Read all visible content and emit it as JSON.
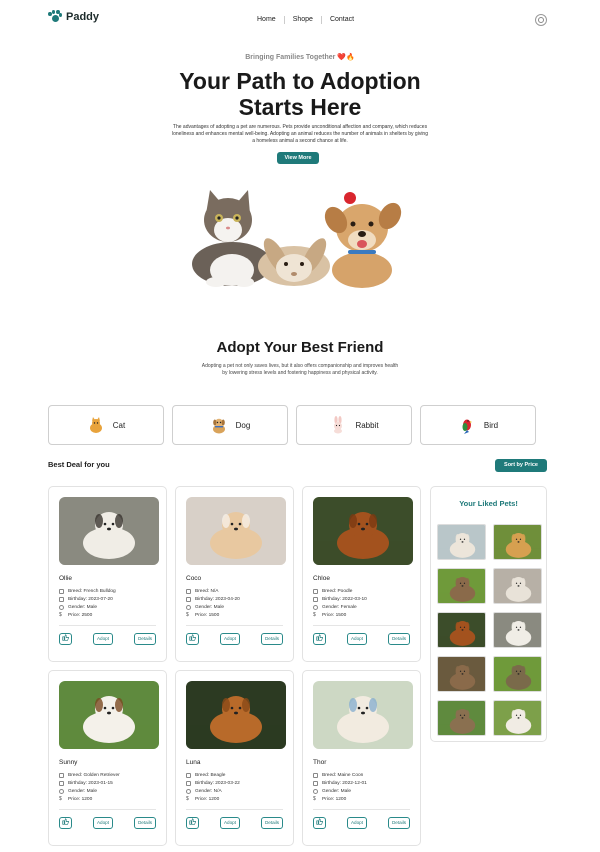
{
  "header": {
    "brand": "Paddy",
    "nav": [
      "Home",
      "Shope",
      "Contact"
    ]
  },
  "hero": {
    "tagline": "Bringing Families Together ❤️🔥",
    "title": "Your Path to Adoption Starts Here",
    "description": "The advantages of adopting a pet are numerous. Pets provide unconditional affection and company, which reduces loneliness and enhances mental well-being. Adopting an animal reduces the number of animals in shelters by giving a homeless animal a second chance at life.",
    "cta": "View More"
  },
  "adopt": {
    "title": "Adopt Your Best Friend",
    "description": "Adopting a pet not only saves lives, but it also offers companionship and improves health by lowering stress levels and fostering happiness and physical activity."
  },
  "categories": [
    {
      "label": "Cat",
      "icon": "cat-icon"
    },
    {
      "label": "Dog",
      "icon": "dog-icon"
    },
    {
      "label": "Rabbit",
      "icon": "rabbit-icon"
    },
    {
      "label": "Bird",
      "icon": "parrot-icon"
    }
  ],
  "deals": {
    "title": "Best Deal for you",
    "sort_label": "Sort by Price"
  },
  "labels": {
    "adopt": "Adopt",
    "details": "Details"
  },
  "pets": [
    {
      "name": "Ollie",
      "breed": "Breed: French Bulldog",
      "birthday": "Birthday: 2023-07-20",
      "gender": "Gender: Male",
      "price": "Price: 2500",
      "photo": "shih-tzu"
    },
    {
      "name": "Coco",
      "breed": "Breed: N/A",
      "birthday": "Birthday: 2023-04-20",
      "gender": "Gender: Male",
      "price": "Price: 1500",
      "photo": "hamster"
    },
    {
      "name": "Chloe",
      "breed": "Breed: Poodle",
      "birthday": "Birthday: 2022-03-10",
      "gender": "Gender: Female",
      "price": "Price: 1500",
      "photo": "retriever"
    },
    {
      "name": "Sunny",
      "breed": "Breed: Golden Retriever",
      "birthday": "Birthday: 2023-01-15",
      "gender": "Gender: Male",
      "price": "Price: 1200",
      "photo": "jack-russell"
    },
    {
      "name": "Luna",
      "breed": "Breed: Beagle",
      "birthday": "Birthday: 2023-03-22",
      "gender": "Gender: N/A",
      "price": "Price: 1200",
      "photo": "golden"
    },
    {
      "name": "Thor",
      "breed": "Breed: Maine Coon",
      "birthday": "Birthday: 2022-12-01",
      "gender": "Gender: Male",
      "price": "Price: 1200",
      "photo": "white-cat"
    }
  ],
  "liked": {
    "title": "Your Liked Pets!"
  },
  "colors": {
    "accent": "#1f7a7a"
  }
}
